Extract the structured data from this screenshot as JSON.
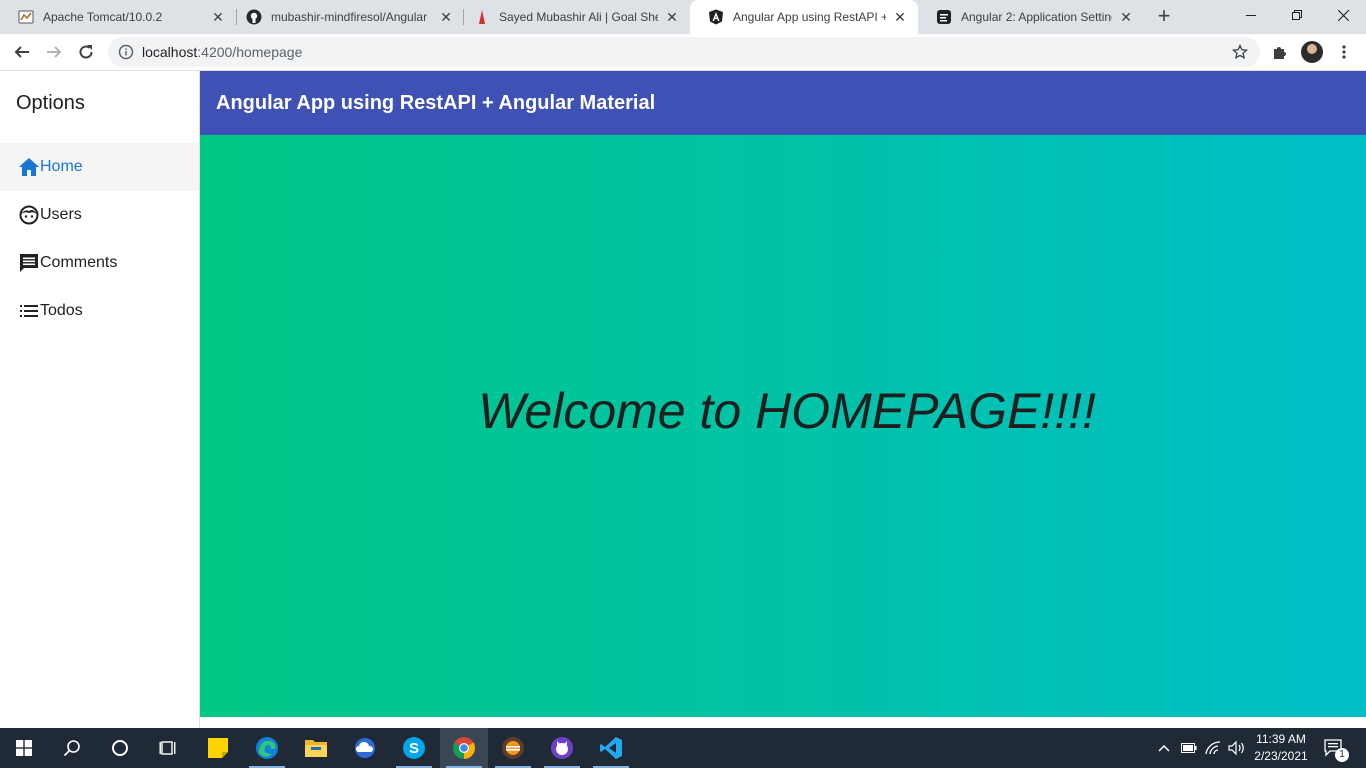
{
  "browser": {
    "tabs": [
      {
        "title": "Apache Tomcat/10.0.2",
        "icon": "tomcat-icon"
      },
      {
        "title": "mubashir-mindfiresol/Angular",
        "icon": "github-icon"
      },
      {
        "title": "Sayed Mubashir Ali | Goal Shee",
        "icon": "goal-icon"
      },
      {
        "title": "Angular App using RestAPI + A",
        "icon": "angular-icon",
        "active": true
      },
      {
        "title": "Angular 2: Application Setting",
        "icon": "doc-icon"
      }
    ],
    "url_host": "localhost",
    "url_path": ":4200/homepage"
  },
  "sidebar": {
    "title": "Options",
    "items": [
      {
        "label": "Home",
        "icon": "home-icon",
        "active": true
      },
      {
        "label": "Users",
        "icon": "face-icon"
      },
      {
        "label": "Comments",
        "icon": "comment-icon"
      },
      {
        "label": "Todos",
        "icon": "list-icon"
      }
    ]
  },
  "header": {
    "title": "Angular App using RestAPI + Angular Material"
  },
  "main": {
    "welcome": "Welcome to HOMEPAGE!!!!"
  },
  "taskbar": {
    "time": "11:39 AM",
    "date": "2/23/2021",
    "notification_count": "1"
  },
  "colors": {
    "toolbar": "#3f51b5",
    "gradient_start": "#00c885",
    "gradient_end": "#00bec8",
    "active_link": "#1976d2"
  }
}
